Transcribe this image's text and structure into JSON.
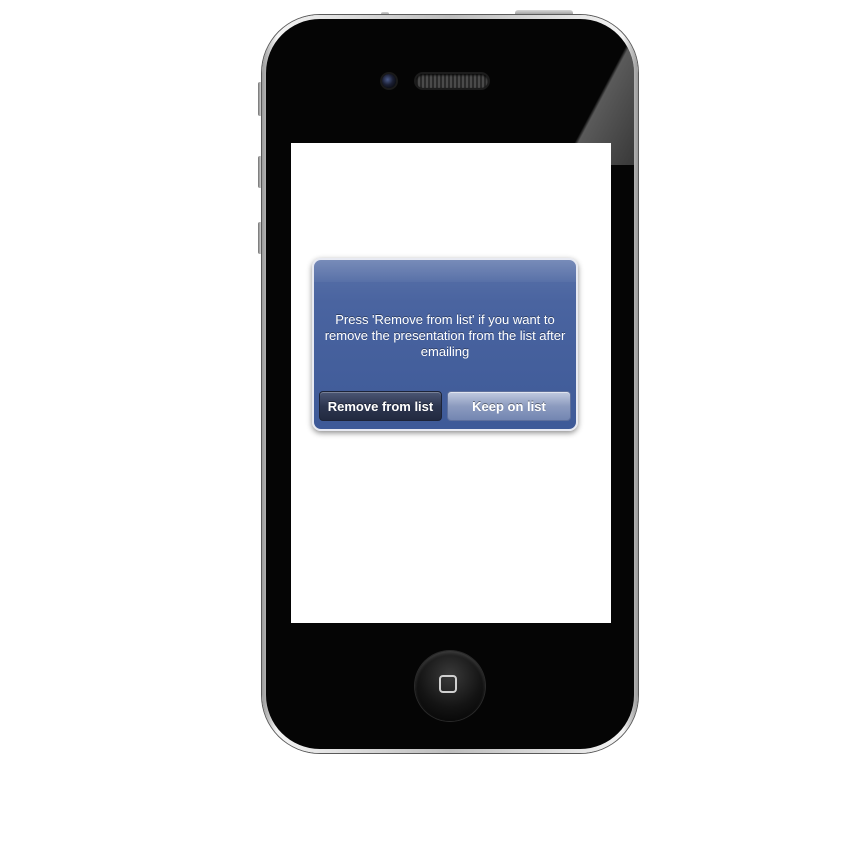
{
  "alert": {
    "message": "Press 'Remove from list' if you want to remove the presentation from the list after emailing",
    "buttons": {
      "remove_label": "Remove from list",
      "keep_label": "Keep on list"
    }
  },
  "device": {
    "icons": {
      "camera": "front-camera-icon",
      "speaker": "earpiece-speaker-icon",
      "home": "home-button-icon"
    }
  },
  "colors": {
    "alert_background": "#4a64a0",
    "remove_button": "#2d3650",
    "keep_button": "#8c9bbf",
    "screen_background": "#ffffff"
  }
}
